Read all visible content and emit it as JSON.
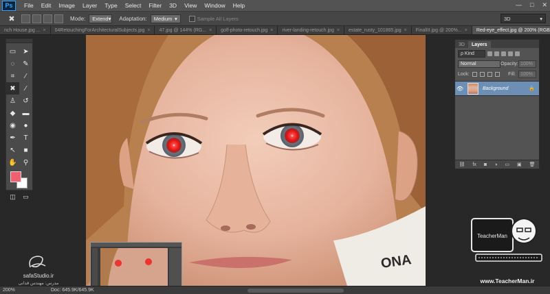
{
  "app": {
    "logo": "Ps"
  },
  "menu": [
    "File",
    "Edit",
    "Image",
    "Layer",
    "Type",
    "Select",
    "Filter",
    "3D",
    "View",
    "Window",
    "Help"
  ],
  "window_controls": [
    "—",
    "□",
    "✕"
  ],
  "options": {
    "mode_label": "Mode:",
    "mode_value": "Extend",
    "adaptation_label": "Adaptation:",
    "adaptation_value": "Medium",
    "sample_all_layers": "Sample All Layers",
    "workspace": "3D"
  },
  "tabs": [
    {
      "label": "nch House.jpg ...",
      "active": false
    },
    {
      "label": "04RetouchingForArchitecturalSubjects.jpg",
      "active": false
    },
    {
      "label": "47.jpg @ 144% (RG...",
      "active": false
    },
    {
      "label": "golf-photo-retouch.jpg",
      "active": false
    },
    {
      "label": "river-landing-retouch.jpg",
      "active": false
    },
    {
      "label": "estate_rusty_101865.jpg",
      "active": false
    },
    {
      "label": "FinalIII.jpg @ 200%...",
      "active": false
    },
    {
      "label": "Red-eye_effect.jpg @ 200% (RGB/8)",
      "active": true
    }
  ],
  "tools": [
    {
      "icon": "move-tool",
      "glyph": "▭"
    },
    {
      "icon": "arrow-tool",
      "glyph": "➤"
    },
    {
      "icon": "lasso-tool",
      "glyph": "◌"
    },
    {
      "icon": "quick-select-tool",
      "glyph": "✎"
    },
    {
      "icon": "crop-tool",
      "glyph": "⌗"
    },
    {
      "icon": "eyedropper-tool",
      "glyph": "⁄"
    },
    {
      "icon": "content-aware-move-tool",
      "glyph": "✖"
    },
    {
      "icon": "brush-tool",
      "glyph": "∕"
    },
    {
      "icon": "stamp-tool",
      "glyph": "♙"
    },
    {
      "icon": "history-brush-tool",
      "glyph": "↺"
    },
    {
      "icon": "eraser-tool",
      "glyph": "◆"
    },
    {
      "icon": "gradient-tool",
      "glyph": "▬"
    },
    {
      "icon": "blur-tool",
      "glyph": "◉"
    },
    {
      "icon": "dodge-tool",
      "glyph": "●"
    },
    {
      "icon": "pen-tool",
      "glyph": "✒"
    },
    {
      "icon": "type-tool",
      "glyph": "T"
    },
    {
      "icon": "path-select-tool",
      "glyph": "↖"
    },
    {
      "icon": "shape-tool",
      "glyph": "■"
    },
    {
      "icon": "hand-tool",
      "glyph": "✋"
    },
    {
      "icon": "zoom-tool",
      "glyph": "⚲"
    }
  ],
  "colors": {
    "foreground": "#f26070",
    "background": "#ffffff",
    "accent": "#6d8fb6"
  },
  "layers_panel": {
    "tabs": [
      "3D",
      "Layers"
    ],
    "kind": "ρ Kind",
    "blend_mode": "Normal",
    "opacity_label": "Opacity:",
    "opacity_value": "100%",
    "lock_label": "Lock:",
    "fill_label": "Fill:",
    "fill_value": "100%",
    "layer_name": "Background",
    "footer_icons": [
      "⛓",
      "fx",
      "◙",
      "◑",
      "▭",
      "▣",
      "🗑"
    ]
  },
  "status": {
    "zoom": "200%",
    "doc": "Doc: 645.9K/645.9K"
  },
  "watermark": {
    "left_site": "safaStudio.ir",
    "left_credit": "مدرس: مهندس قدانی",
    "right_url": "www.TeacherMan.ir",
    "right_badge": "TeacherMan"
  }
}
